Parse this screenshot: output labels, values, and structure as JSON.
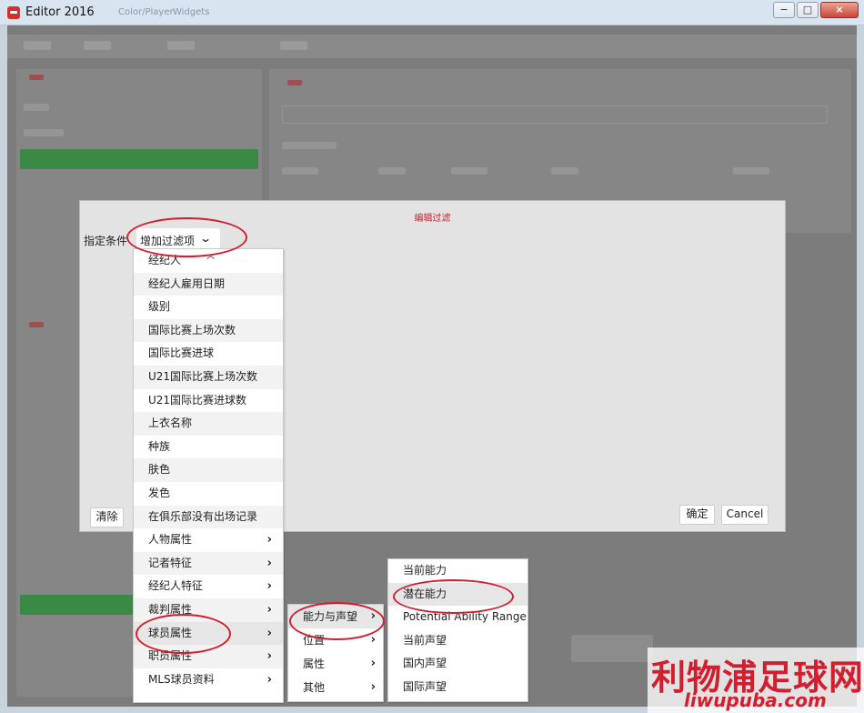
{
  "window": {
    "title": "Editor 2016",
    "faint_tab1": "Color/Player",
    "faint_tab2": "Widgets",
    "controls": {
      "minimize": "−",
      "maximize": "□",
      "close": "×"
    }
  },
  "dialog": {
    "title": "编辑过滤",
    "condition_label": "指定条件",
    "add_filter_label": "增加过滤项",
    "chevron": "⌄",
    "clear_button": "清除",
    "ok_button": "确定",
    "cancel_button": "Cancel"
  },
  "menu1": {
    "scroll_up": "︿",
    "items": [
      {
        "label": "经纪人",
        "submenu": false
      },
      {
        "label": "经纪人雇用日期",
        "submenu": false
      },
      {
        "label": "级别",
        "submenu": false
      },
      {
        "label": "国际比赛上场次数",
        "submenu": false
      },
      {
        "label": "国际比赛进球",
        "submenu": false
      },
      {
        "label": "U21国际比赛上场次数",
        "submenu": false
      },
      {
        "label": "U21国际比赛进球数",
        "submenu": false
      },
      {
        "label": "上衣名称",
        "submenu": false
      },
      {
        "label": "种族",
        "submenu": false
      },
      {
        "label": "肤色",
        "submenu": false
      },
      {
        "label": "发色",
        "submenu": false
      },
      {
        "label": "在俱乐部没有出场记录",
        "submenu": false
      },
      {
        "label": "人物属性",
        "submenu": true
      },
      {
        "label": "记者特征",
        "submenu": true
      },
      {
        "label": "经纪人特征",
        "submenu": true
      },
      {
        "label": "裁判属性",
        "submenu": true
      },
      {
        "label": "球员属性",
        "submenu": true
      },
      {
        "label": "职员属性",
        "submenu": true
      },
      {
        "label": "MLS球员资料",
        "submenu": true
      }
    ]
  },
  "menu2": {
    "items": [
      {
        "label": "能力与声望",
        "submenu": true
      },
      {
        "label": "位置",
        "submenu": true
      },
      {
        "label": "属性",
        "submenu": true
      },
      {
        "label": "其他",
        "submenu": true
      }
    ]
  },
  "menu3": {
    "items": [
      {
        "label": "当前能力"
      },
      {
        "label": "潜在能力"
      },
      {
        "label": "Potential Ability Range"
      },
      {
        "label": "当前声望"
      },
      {
        "label": "国内声望"
      },
      {
        "label": "国际声望"
      }
    ]
  },
  "arrow_glyph": "›",
  "watermark": {
    "chinese": "利物浦足球网",
    "url": "liwupuba.com"
  },
  "colors": {
    "annotation": "#d11f2f",
    "dialog_title": "#c0202a",
    "selection_green": "#3a8a46"
  }
}
